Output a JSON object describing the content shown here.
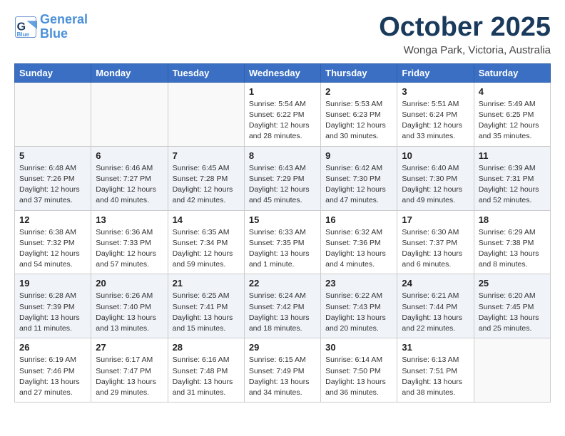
{
  "header": {
    "logo_line1": "General",
    "logo_line2": "Blue",
    "month": "October 2025",
    "location": "Wonga Park, Victoria, Australia"
  },
  "weekdays": [
    "Sunday",
    "Monday",
    "Tuesday",
    "Wednesday",
    "Thursday",
    "Friday",
    "Saturday"
  ],
  "weeks": [
    [
      {
        "day": "",
        "info": ""
      },
      {
        "day": "",
        "info": ""
      },
      {
        "day": "",
        "info": ""
      },
      {
        "day": "1",
        "info": "Sunrise: 5:54 AM\nSunset: 6:22 PM\nDaylight: 12 hours\nand 28 minutes."
      },
      {
        "day": "2",
        "info": "Sunrise: 5:53 AM\nSunset: 6:23 PM\nDaylight: 12 hours\nand 30 minutes."
      },
      {
        "day": "3",
        "info": "Sunrise: 5:51 AM\nSunset: 6:24 PM\nDaylight: 12 hours\nand 33 minutes."
      },
      {
        "day": "4",
        "info": "Sunrise: 5:49 AM\nSunset: 6:25 PM\nDaylight: 12 hours\nand 35 minutes."
      }
    ],
    [
      {
        "day": "5",
        "info": "Sunrise: 6:48 AM\nSunset: 7:26 PM\nDaylight: 12 hours\nand 37 minutes."
      },
      {
        "day": "6",
        "info": "Sunrise: 6:46 AM\nSunset: 7:27 PM\nDaylight: 12 hours\nand 40 minutes."
      },
      {
        "day": "7",
        "info": "Sunrise: 6:45 AM\nSunset: 7:28 PM\nDaylight: 12 hours\nand 42 minutes."
      },
      {
        "day": "8",
        "info": "Sunrise: 6:43 AM\nSunset: 7:29 PM\nDaylight: 12 hours\nand 45 minutes."
      },
      {
        "day": "9",
        "info": "Sunrise: 6:42 AM\nSunset: 7:30 PM\nDaylight: 12 hours\nand 47 minutes."
      },
      {
        "day": "10",
        "info": "Sunrise: 6:40 AM\nSunset: 7:30 PM\nDaylight: 12 hours\nand 49 minutes."
      },
      {
        "day": "11",
        "info": "Sunrise: 6:39 AM\nSunset: 7:31 PM\nDaylight: 12 hours\nand 52 minutes."
      }
    ],
    [
      {
        "day": "12",
        "info": "Sunrise: 6:38 AM\nSunset: 7:32 PM\nDaylight: 12 hours\nand 54 minutes."
      },
      {
        "day": "13",
        "info": "Sunrise: 6:36 AM\nSunset: 7:33 PM\nDaylight: 12 hours\nand 57 minutes."
      },
      {
        "day": "14",
        "info": "Sunrise: 6:35 AM\nSunset: 7:34 PM\nDaylight: 12 hours\nand 59 minutes."
      },
      {
        "day": "15",
        "info": "Sunrise: 6:33 AM\nSunset: 7:35 PM\nDaylight: 13 hours\nand 1 minute."
      },
      {
        "day": "16",
        "info": "Sunrise: 6:32 AM\nSunset: 7:36 PM\nDaylight: 13 hours\nand 4 minutes."
      },
      {
        "day": "17",
        "info": "Sunrise: 6:30 AM\nSunset: 7:37 PM\nDaylight: 13 hours\nand 6 minutes."
      },
      {
        "day": "18",
        "info": "Sunrise: 6:29 AM\nSunset: 7:38 PM\nDaylight: 13 hours\nand 8 minutes."
      }
    ],
    [
      {
        "day": "19",
        "info": "Sunrise: 6:28 AM\nSunset: 7:39 PM\nDaylight: 13 hours\nand 11 minutes."
      },
      {
        "day": "20",
        "info": "Sunrise: 6:26 AM\nSunset: 7:40 PM\nDaylight: 13 hours\nand 13 minutes."
      },
      {
        "day": "21",
        "info": "Sunrise: 6:25 AM\nSunset: 7:41 PM\nDaylight: 13 hours\nand 15 minutes."
      },
      {
        "day": "22",
        "info": "Sunrise: 6:24 AM\nSunset: 7:42 PM\nDaylight: 13 hours\nand 18 minutes."
      },
      {
        "day": "23",
        "info": "Sunrise: 6:22 AM\nSunset: 7:43 PM\nDaylight: 13 hours\nand 20 minutes."
      },
      {
        "day": "24",
        "info": "Sunrise: 6:21 AM\nSunset: 7:44 PM\nDaylight: 13 hours\nand 22 minutes."
      },
      {
        "day": "25",
        "info": "Sunrise: 6:20 AM\nSunset: 7:45 PM\nDaylight: 13 hours\nand 25 minutes."
      }
    ],
    [
      {
        "day": "26",
        "info": "Sunrise: 6:19 AM\nSunset: 7:46 PM\nDaylight: 13 hours\nand 27 minutes."
      },
      {
        "day": "27",
        "info": "Sunrise: 6:17 AM\nSunset: 7:47 PM\nDaylight: 13 hours\nand 29 minutes."
      },
      {
        "day": "28",
        "info": "Sunrise: 6:16 AM\nSunset: 7:48 PM\nDaylight: 13 hours\nand 31 minutes."
      },
      {
        "day": "29",
        "info": "Sunrise: 6:15 AM\nSunset: 7:49 PM\nDaylight: 13 hours\nand 34 minutes."
      },
      {
        "day": "30",
        "info": "Sunrise: 6:14 AM\nSunset: 7:50 PM\nDaylight: 13 hours\nand 36 minutes."
      },
      {
        "day": "31",
        "info": "Sunrise: 6:13 AM\nSunset: 7:51 PM\nDaylight: 13 hours\nand 38 minutes."
      },
      {
        "day": "",
        "info": ""
      }
    ]
  ]
}
